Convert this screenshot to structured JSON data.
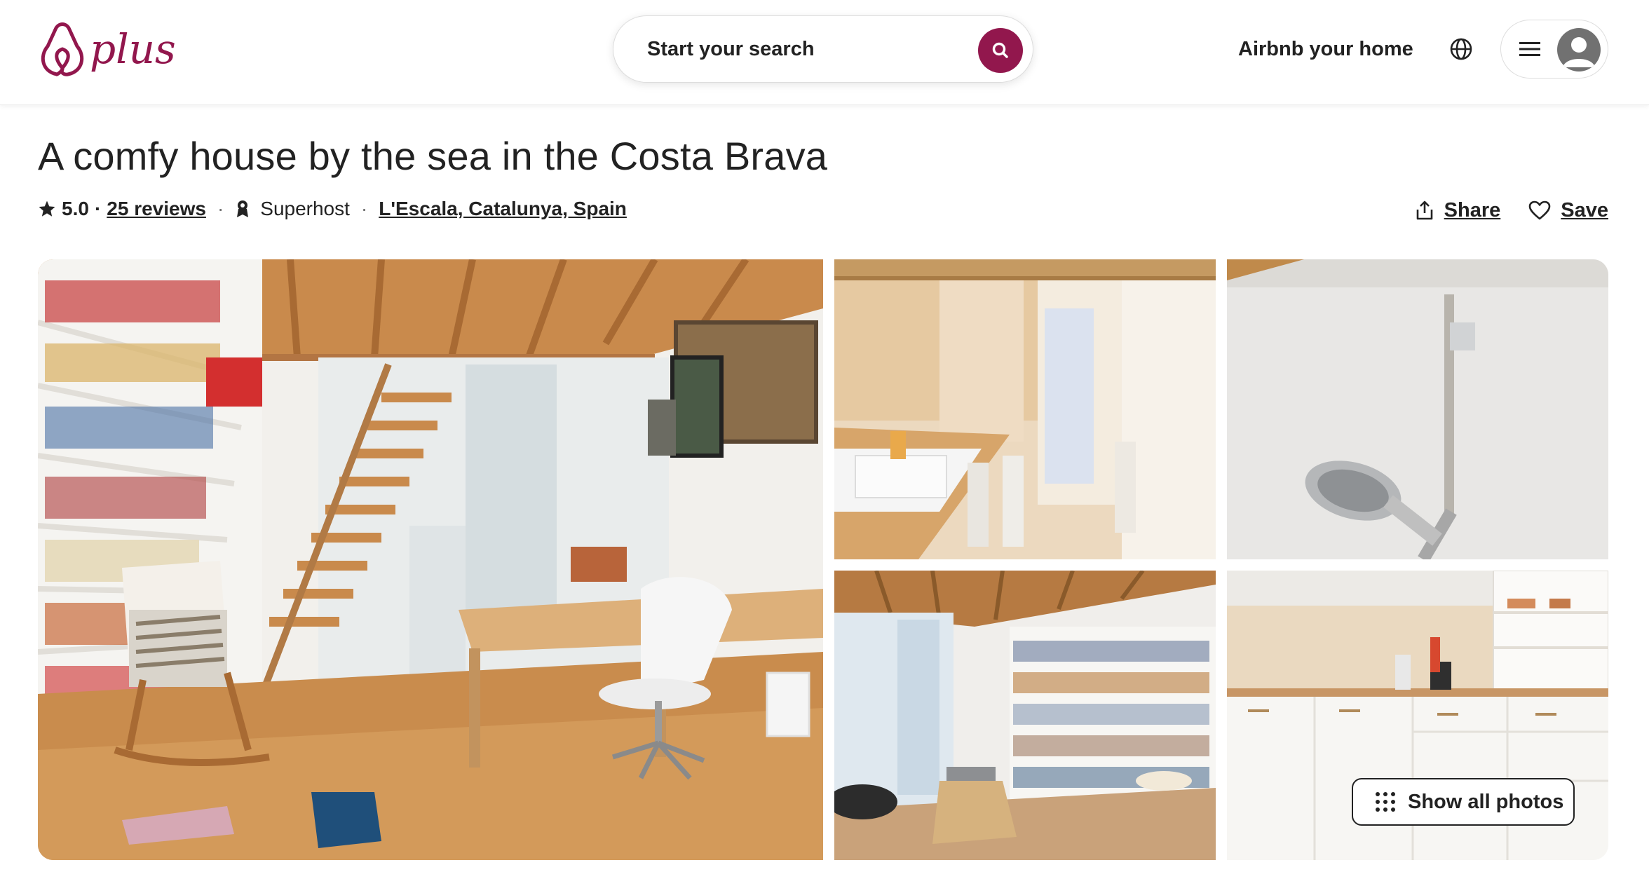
{
  "brand": {
    "name": "plus",
    "color": "#92174d"
  },
  "search": {
    "placeholder": "Start your search"
  },
  "header": {
    "host_link": "Airbnb your home"
  },
  "listing": {
    "title": "A comfy house by the sea in the Costa Brava",
    "rating": "5.0",
    "reviews": "25 reviews",
    "badge": "Superhost",
    "location": "L'Escala, Catalunya, Spain"
  },
  "actions": {
    "share": "Share",
    "save": "Save"
  },
  "gallery": {
    "photos": [
      "living-room-bookshelves-staircase",
      "bathroom-double-sink",
      "shower-head",
      "reading-room-bookshelves",
      "kitchen"
    ],
    "show_all_label": "Show all photos"
  },
  "icons": [
    "search-icon",
    "globe-icon",
    "hamburger-icon",
    "avatar-icon",
    "star-icon",
    "superhost-icon",
    "share-icon",
    "heart-icon",
    "grid-dots-icon"
  ]
}
